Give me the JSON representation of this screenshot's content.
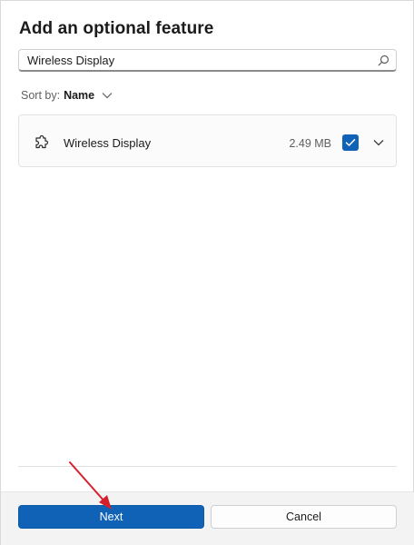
{
  "dialog": {
    "title": "Add an optional feature"
  },
  "search": {
    "value": "Wireless Display",
    "icon": "search-icon"
  },
  "sort": {
    "label": "Sort by:",
    "value": "Name"
  },
  "features": [
    {
      "name": "Wireless Display",
      "size": "2.49 MB",
      "checked": true,
      "icon": "puzzle-icon"
    }
  ],
  "buttons": {
    "next": "Next",
    "cancel": "Cancel"
  },
  "colors": {
    "accent": "#0f62b6",
    "annotation_arrow": "#d4202a"
  }
}
